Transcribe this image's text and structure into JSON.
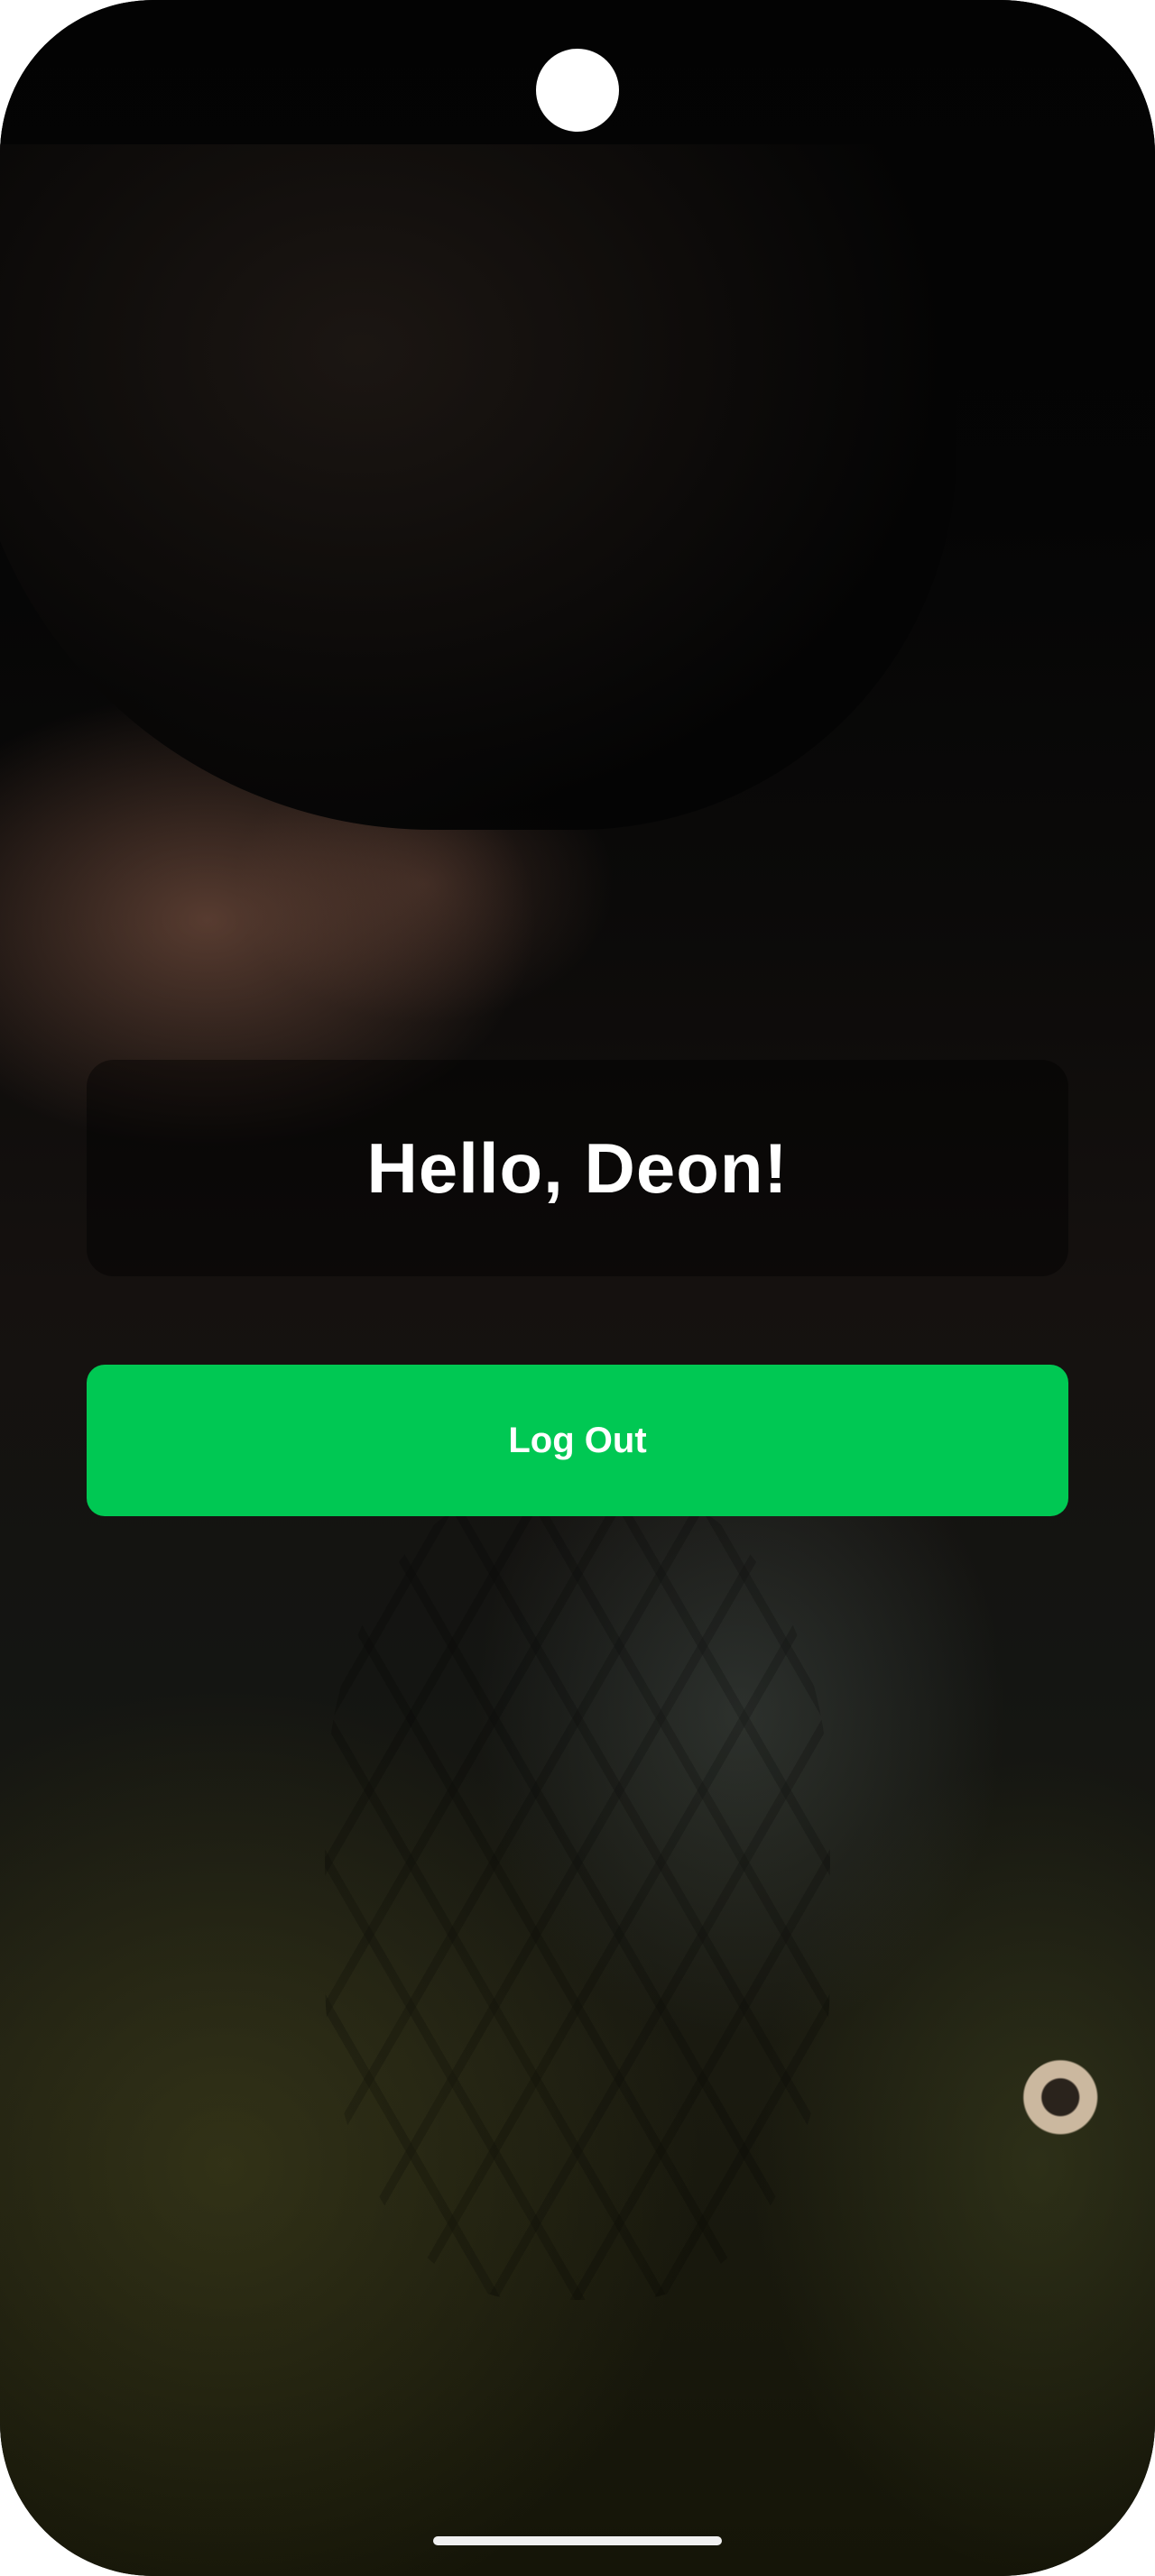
{
  "greeting": {
    "text": "Hello, Deon!"
  },
  "actions": {
    "logout_label": "Log Out"
  },
  "colors": {
    "primary_button": "#00c853",
    "text": "#ffffff"
  }
}
